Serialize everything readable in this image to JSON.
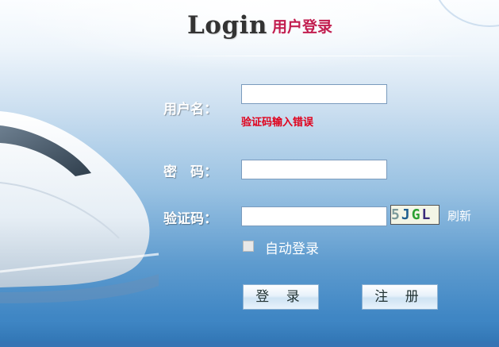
{
  "title": {
    "en": "Login",
    "cn": "用户登录"
  },
  "form": {
    "username_label": "用户名：",
    "username_value": "",
    "username_error": "验证码输入错误",
    "password_label": "密　码：",
    "password_value": "",
    "captcha_label": "验证码：",
    "captcha_value": "",
    "captcha_text": [
      "5",
      "J",
      "G",
      "L"
    ],
    "refresh_label": "刷新",
    "remember_label": "自动登录",
    "login_button": "登 录",
    "register_button": "注 册"
  },
  "colors": {
    "title_cn": "#c21d4f",
    "error": "#e0001b",
    "captcha_chars": [
      "#7b9a9a",
      "#1e5f8f",
      "#2aa032",
      "#3b2a7a"
    ]
  }
}
